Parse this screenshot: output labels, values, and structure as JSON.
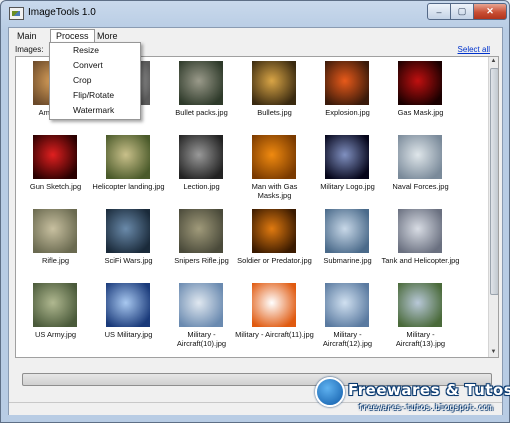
{
  "window": {
    "title": "ImageTools 1.0"
  },
  "controls": {
    "minimize": "–",
    "maximize": "▢",
    "close": "✕"
  },
  "menubar": {
    "main": "Main",
    "process": "Process",
    "more": "More"
  },
  "process_menu": [
    "Resize",
    "Convert",
    "Crop",
    "Flip/Rotate",
    "Watermark"
  ],
  "toolbar": {
    "images_label": "Images:",
    "select_all": "Select all"
  },
  "thumbnails": [
    {
      "label": "America...",
      "colors": [
        "#6b4a2a",
        "#d9a05a"
      ]
    },
    {
      "label": "",
      "colors": [
        "#5a5a5a",
        "#bbbbbb"
      ]
    },
    {
      "label": "Bullet packs.jpg",
      "colors": [
        "#2e3a2a",
        "#9a9a8a"
      ]
    },
    {
      "label": "Bullets.jpg",
      "colors": [
        "#3a2a10",
        "#d9a546"
      ]
    },
    {
      "label": "Explosion.jpg",
      "colors": [
        "#3a1a0a",
        "#e85a1a"
      ]
    },
    {
      "label": "Gas Mask.jpg",
      "colors": [
        "#1a0000",
        "#c01010"
      ]
    },
    {
      "label": "Gun Sketch.jpg",
      "colors": [
        "#2a0000",
        "#e02020"
      ]
    },
    {
      "label": "Helicopter landing.jpg",
      "colors": [
        "#4a5a2a",
        "#c9c08a"
      ]
    },
    {
      "label": "Lection.jpg",
      "colors": [
        "#222222",
        "#999999"
      ]
    },
    {
      "label": "Man with Gas Masks.jpg",
      "colors": [
        "#7a3a00",
        "#f08a10"
      ]
    },
    {
      "label": "Military Logo.jpg",
      "colors": [
        "#05051a",
        "#8090c0"
      ]
    },
    {
      "label": "Naval Forces.jpg",
      "colors": [
        "#7a8a9a",
        "#dfe6ea"
      ]
    },
    {
      "label": "Rifle.jpg",
      "colors": [
        "#6a6a50",
        "#c8c0a0"
      ]
    },
    {
      "label": "SciFi Wars.jpg",
      "colors": [
        "#1a2a3a",
        "#6a8aaa"
      ]
    },
    {
      "label": "Snipers Rifle.jpg",
      "colors": [
        "#4a4a3a",
        "#a09a7a"
      ]
    },
    {
      "label": "Soldier or Predator.jpg",
      "colors": [
        "#3a1a00",
        "#e07a10"
      ]
    },
    {
      "label": "Submarine.jpg",
      "colors": [
        "#4a6a8a",
        "#c8d8e8"
      ]
    },
    {
      "label": "Tank and Helicopter.jpg",
      "colors": [
        "#6a7080",
        "#d8dce4"
      ]
    },
    {
      "label": "US Army.jpg",
      "colors": [
        "#4a5a3a",
        "#b0b890"
      ]
    },
    {
      "label": "US Military.jpg",
      "colors": [
        "#1a3a7a",
        "#a8c8f0"
      ]
    },
    {
      "label": "Military - Aircraft(10).jpg",
      "colors": [
        "#6a8ab0",
        "#e0e8f0"
      ]
    },
    {
      "label": "Military - Aircraft(11).jpg",
      "colors": [
        "#e05a10",
        "#ffffff"
      ]
    },
    {
      "label": "Military - Aircraft(12).jpg",
      "colors": [
        "#5a7aa0",
        "#d0e0f0"
      ]
    },
    {
      "label": "Military - Aircraft(13).jpg",
      "colors": [
        "#4a6a3a",
        "#b8c8d8"
      ]
    },
    {
      "label": "",
      "colors": [
        "#3060a0",
        "#d0e0f0"
      ]
    },
    {
      "label": "",
      "colors": [
        "#4070b0",
        "#c0d0e0"
      ]
    },
    {
      "label": "",
      "colors": [
        "#6080a0",
        "#dfe8ef"
      ]
    },
    {
      "label": "",
      "colors": [
        "#5070a0",
        "#d8e4f0"
      ]
    },
    {
      "label": "",
      "colors": [
        "#7090b0",
        "#e0e8f0"
      ]
    },
    {
      "label": "",
      "colors": [
        "#5a7090",
        "#e8eef4"
      ]
    }
  ],
  "watermark": {
    "title": "Freewares & Tutos",
    "url": "freewares-tutos.blogspot.com"
  }
}
